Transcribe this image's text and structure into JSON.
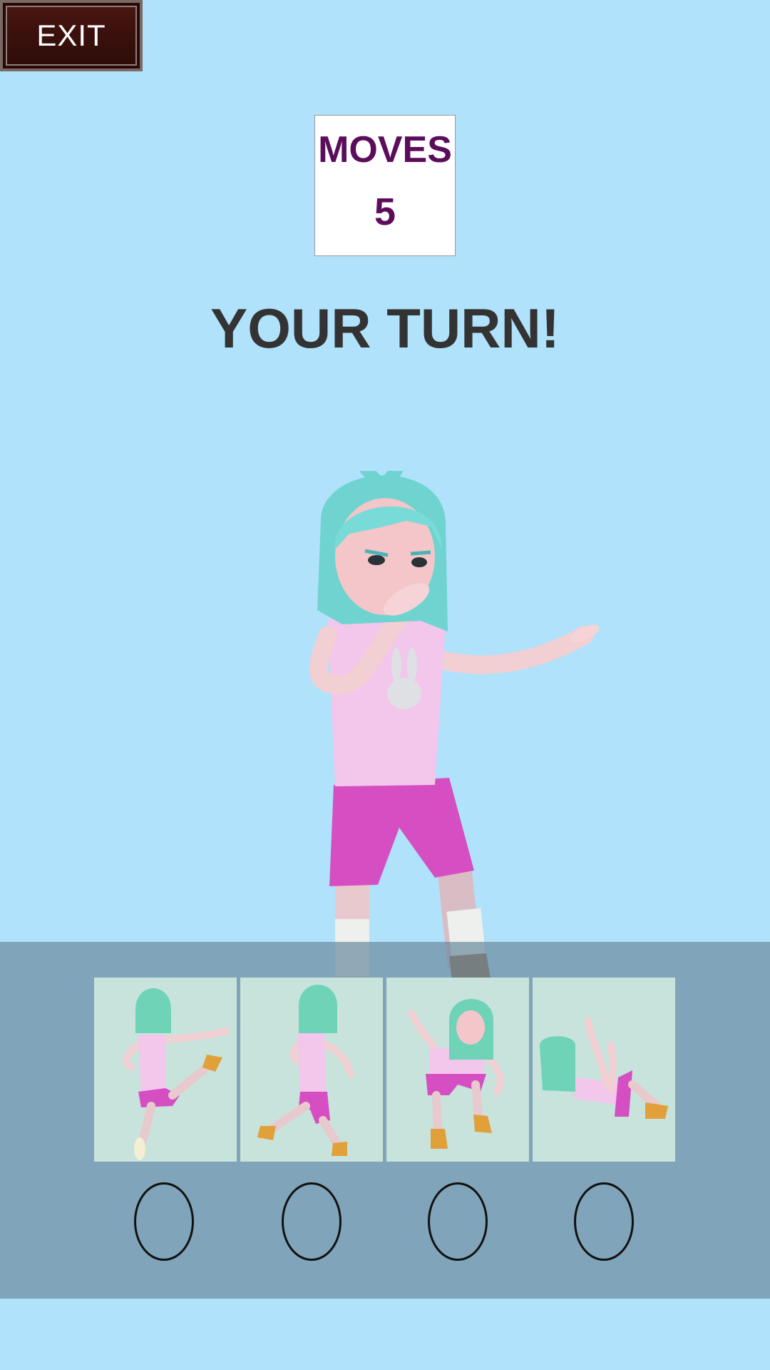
{
  "exit_label": "EXIT",
  "moves": {
    "label": "MOVES",
    "value": "5"
  },
  "turn_text": "YOUR TURN!",
  "move_cards": [
    {
      "pose": "kick-right"
    },
    {
      "pose": "step-back"
    },
    {
      "pose": "crouch-arms-up"
    },
    {
      "pose": "fall-back"
    }
  ],
  "answer_slots": 4,
  "colors": {
    "background": "#b0e2fb",
    "tray": "#8aafc6",
    "card": "#c8e3dc",
    "moves_text": "#5b0d5c",
    "turn_text": "#333333"
  }
}
